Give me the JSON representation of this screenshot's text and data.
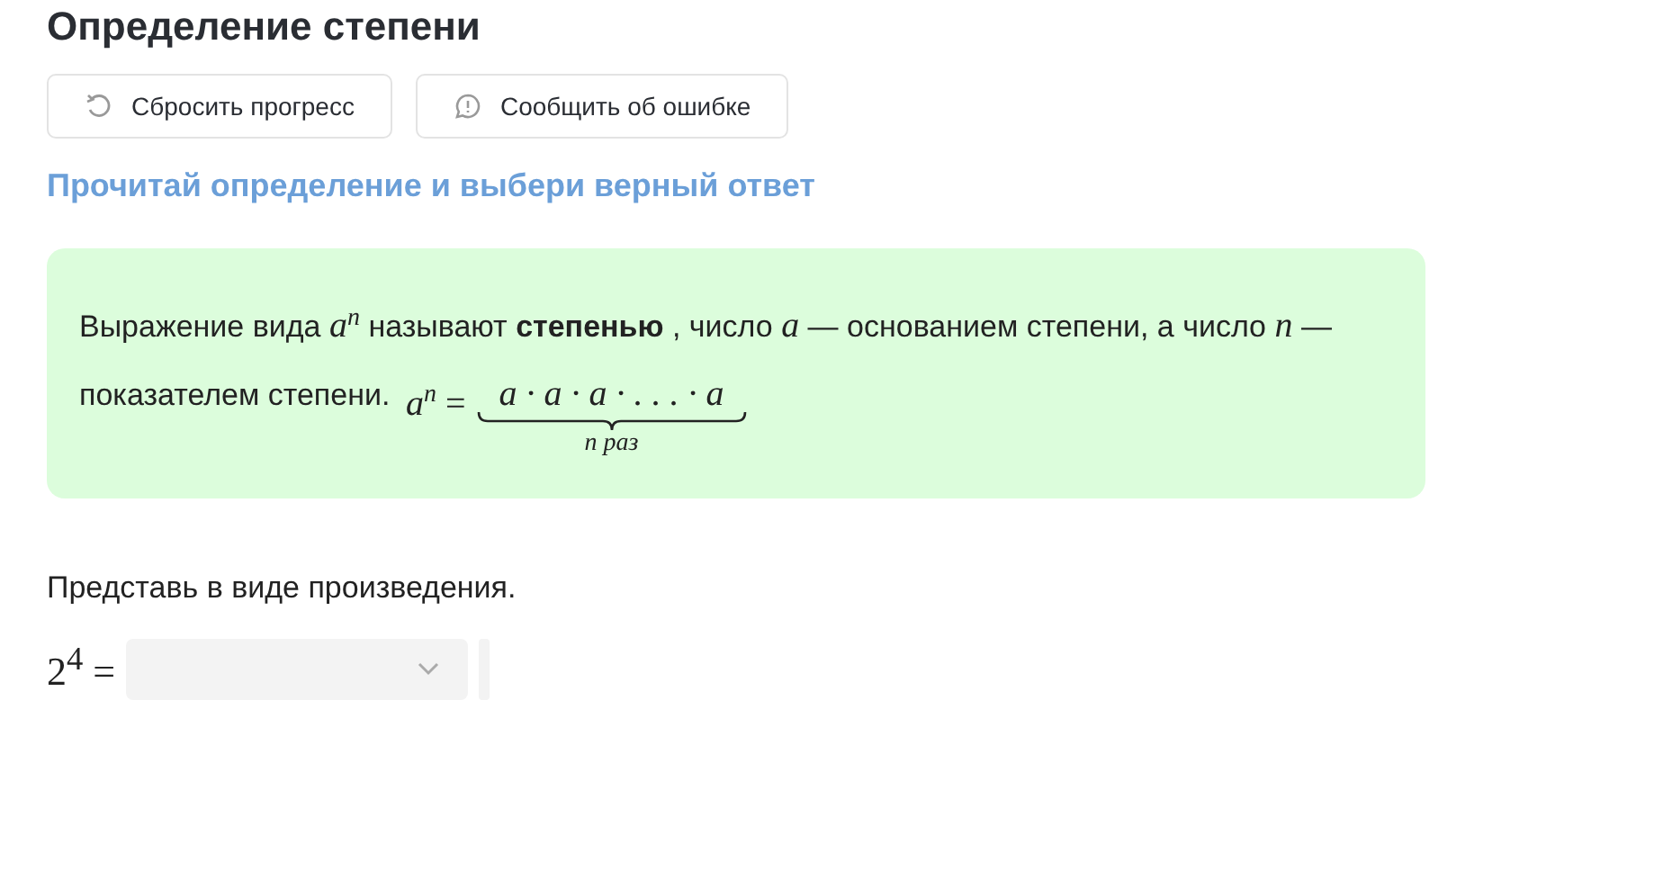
{
  "title": "Определение степени",
  "buttons": [
    {
      "kind": "reset",
      "label": "Сбросить прогресс"
    },
    {
      "kind": "report",
      "label": "Сообщить об ошибке"
    }
  ],
  "instruction": "Прочитай определение и выбери верный ответ",
  "definition": {
    "text": "Выражение вида *a*$^{n}$ называют **степенью** , число *a* — основанием степени, а число *n* — показателем степени.",
    "formula_left": "*a*$^{n}$ =",
    "product": "a · a · a · . . . · a",
    "brace_label": "n раз"
  },
  "task": {
    "prompt": "Представь в виде произведения.",
    "expression": "2$^{4}$ ="
  }
}
